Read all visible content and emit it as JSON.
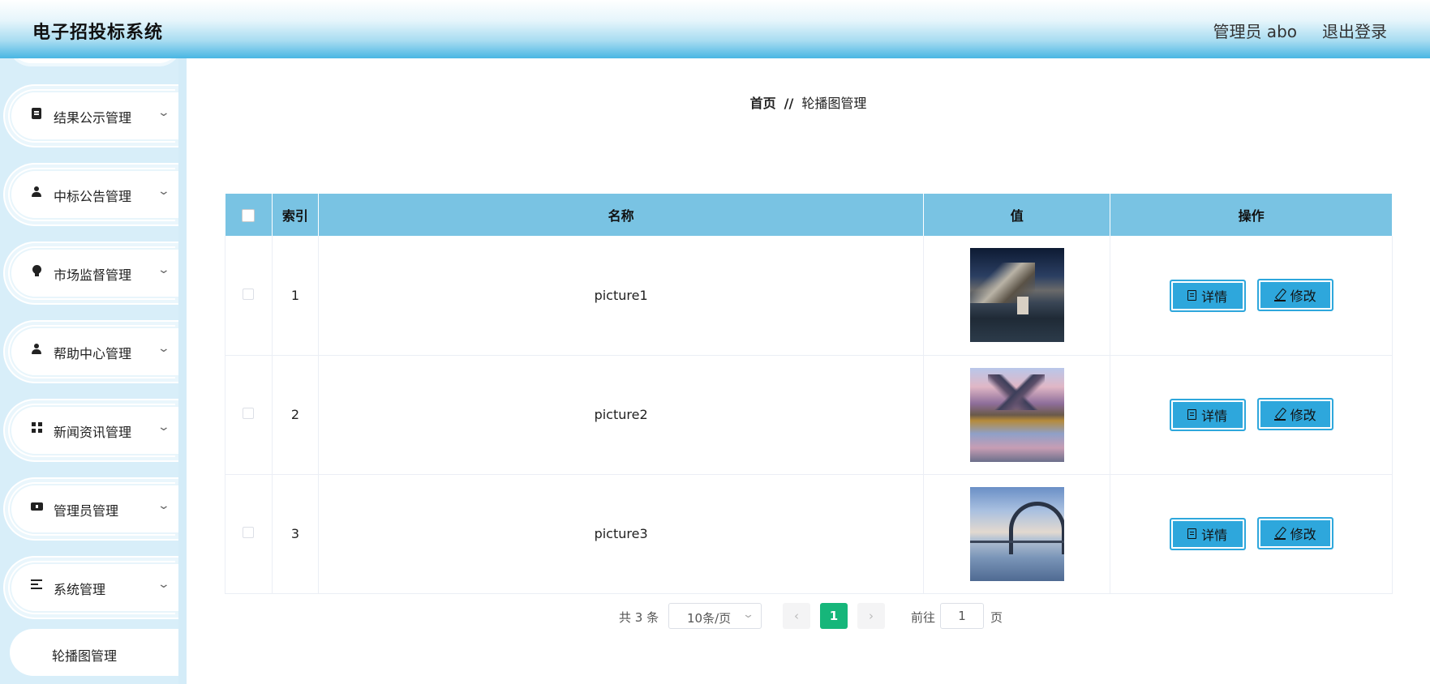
{
  "header": {
    "title": "电子招投标系统",
    "user": "管理员 abo",
    "logout": "退出登录"
  },
  "sidebar": {
    "items": [
      {
        "label": "结果公示管理",
        "icon": "clipboard-icon"
      },
      {
        "label": "中标公告管理",
        "icon": "user-icon"
      },
      {
        "label": "市场监督管理",
        "icon": "bulb-icon"
      },
      {
        "label": "帮助中心管理",
        "icon": "person-icon"
      },
      {
        "label": "新闻资讯管理",
        "icon": "grid-icon"
      },
      {
        "label": "管理员管理",
        "icon": "ticket-icon"
      },
      {
        "label": "系统管理",
        "icon": "list-icon"
      }
    ],
    "sub_item": "轮播图管理"
  },
  "breadcrumb": {
    "home": "首页",
    "separator": "//",
    "current": "轮播图管理"
  },
  "table": {
    "columns": [
      "索引",
      "名称",
      "值",
      "操作"
    ],
    "rows": [
      {
        "index": "1",
        "name": "picture1"
      },
      {
        "index": "2",
        "name": "picture2"
      },
      {
        "index": "3",
        "name": "picture3"
      }
    ],
    "detail_label": "详情",
    "edit_label": "修改"
  },
  "pagination": {
    "total": "共 3 条",
    "page_size": "10条/页",
    "current_page": "1",
    "goto_label": "前往",
    "goto_value": "1",
    "page_suffix": "页"
  },
  "colors": {
    "header_accent": "#49b6e3",
    "table_header": "#79c3e3",
    "button": "#2ea7dc",
    "active_page": "#16b67a",
    "sidebar_bg": "#d8eef9"
  }
}
